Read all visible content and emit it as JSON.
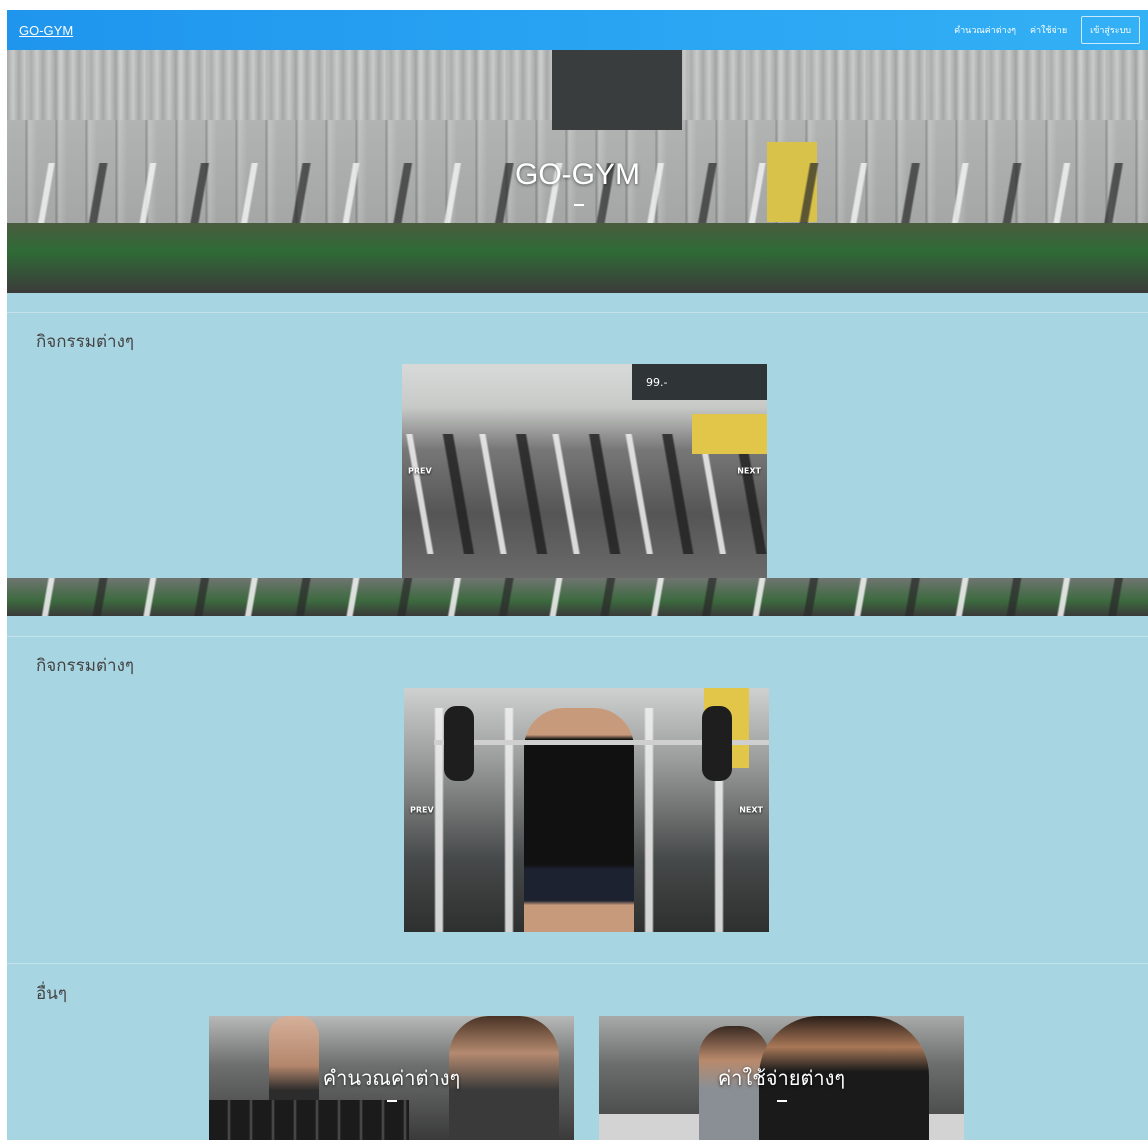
{
  "navbar": {
    "brand": "GO-GYM",
    "links": [
      "คำนวณค่าต่างๆ",
      "ค่าใช้จ่าย"
    ],
    "login": "เข้าสู่ระบบ"
  },
  "hero": {
    "title": "GO-GYM"
  },
  "sections": [
    {
      "heading": "กิจกรรมต่างๆ",
      "carousel": {
        "poster_text": "99.-",
        "prev": "PREV",
        "next": "NEXT"
      }
    },
    {
      "heading": "กิจกรรมต่างๆ",
      "carousel": {
        "prev": "PREV",
        "next": "NEXT"
      }
    },
    {
      "heading": "อื่นๆ",
      "cards": [
        {
          "title": "คำนวณค่าต่างๆ"
        },
        {
          "title": "ค่าใช้จ่ายต่างๆ"
        }
      ]
    }
  ]
}
